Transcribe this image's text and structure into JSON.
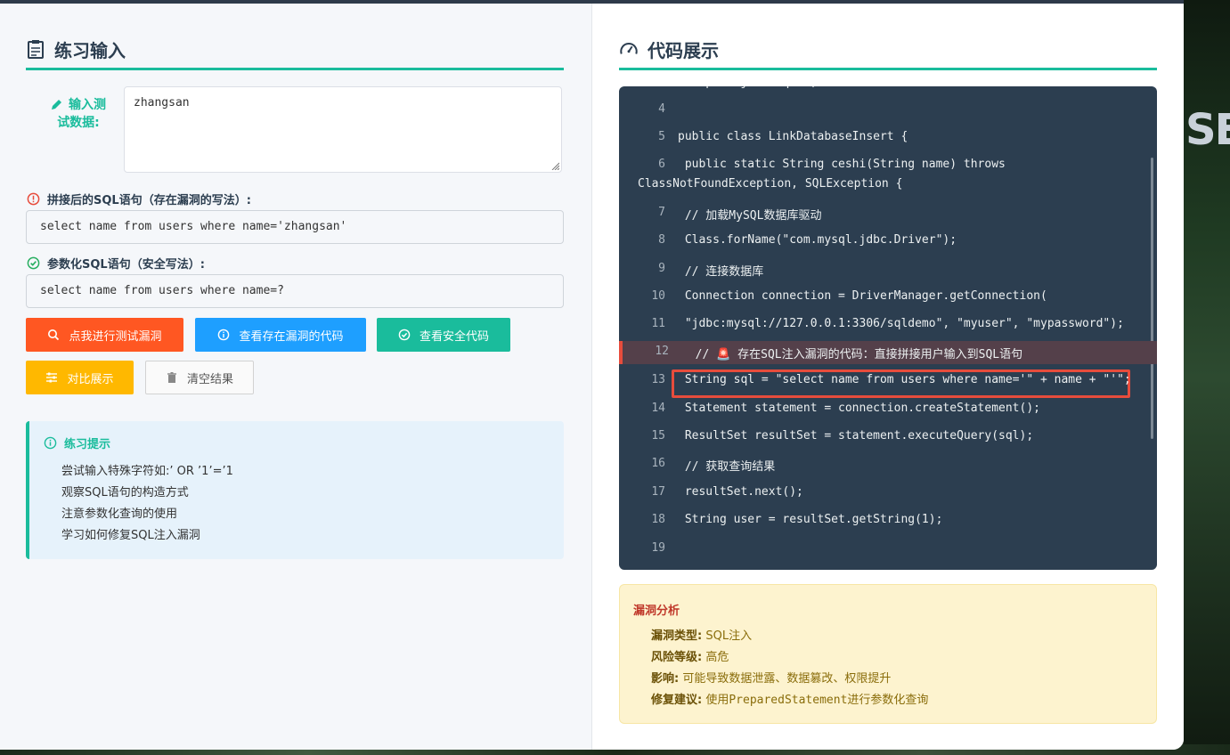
{
  "left": {
    "title": "练习输入",
    "test_input_label": "输入测试数据:",
    "test_input_value": "zhangsan",
    "vulnerable_label": "拼接后的SQL语句（存在漏洞的写法）:",
    "vulnerable_sql": "select name from users where name='zhangsan'",
    "safe_label": "参数化SQL语句（安全写法）:",
    "safe_sql": "select name from users where name=?",
    "buttons": {
      "test": "点我进行测试漏洞",
      "view_vuln": "查看存在漏洞的代码",
      "view_safe": "查看安全代码",
      "compare": "对比展示",
      "clear": "清空结果"
    },
    "tips": {
      "title": "练习提示",
      "items": [
        "尝试输入特殊字符如:’ OR ’1’=’1",
        "观察SQL语句的构造方式",
        "注意参数化查询的使用",
        "学习如何修复SQL注入漏洞"
      ]
    }
  },
  "right": {
    "title": "代码展示",
    "code_lines": [
      {
        "n": "4",
        "code": ""
      },
      {
        "n": "5",
        "code": "public class LinkDatabaseInsert {"
      },
      {
        "n": "6",
        "code": " public static String ceshi(String name) throws"
      },
      {
        "n": "",
        "code": "ClassNotFoundException, SQLException {"
      },
      {
        "n": "7",
        "code": " // 加载MySQL数据库驱动"
      },
      {
        "n": "8",
        "code": " Class.forName(\"com.mysql.jdbc.Driver\");"
      },
      {
        "n": "9",
        "code": " // 连接数据库"
      },
      {
        "n": "10",
        "code": " Connection connection = DriverManager.getConnection("
      },
      {
        "n": "11",
        "code": " \"jdbc:mysql://127.0.0.1:3306/sqldemo\", \"myuser\", \"mypassword\");"
      },
      {
        "n": "12",
        "code": "  // 🚨 存在SQL注入漏洞的代码：直接拼接用户输入到SQL语句"
      },
      {
        "n": "13",
        "code": " String sql = \"select name from users where name='\" + name + \"'\";"
      },
      {
        "n": "14",
        "code": " Statement statement = connection.createStatement();"
      },
      {
        "n": "15",
        "code": " ResultSet resultSet = statement.executeQuery(sql);"
      },
      {
        "n": "16",
        "code": " // 获取查询结果"
      },
      {
        "n": "17",
        "code": " resultSet.next();"
      },
      {
        "n": "18",
        "code": " String user = resultSet.getString(1);"
      },
      {
        "n": "19",
        "code": ""
      }
    ],
    "vuln": {
      "title": "漏洞分析",
      "type_label": "漏洞类型:",
      "type_value": "SQL注入",
      "risk_label": "风险等级:",
      "risk_value": "高危",
      "impact_label": "影响:",
      "impact_value": "可能导致数据泄露、数据篡改、权限提升",
      "fix_label": "修复建议:",
      "fix_value": "使用PreparedStatement进行参数化查询"
    }
  },
  "colors": {
    "accent": "#1abc9c",
    "danger": "#e74c3c",
    "orange": "#ff5722",
    "blue": "#1e9fff",
    "yellow": "#ffb800",
    "code_bg": "#2c3e50"
  },
  "background_text": "SE"
}
